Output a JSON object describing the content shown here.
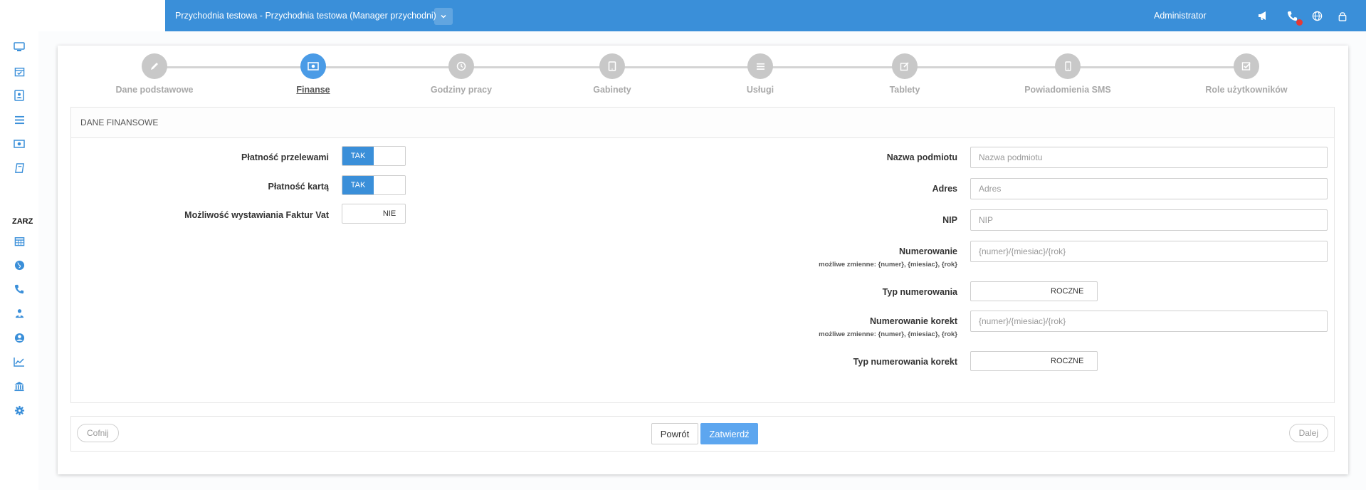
{
  "header": {
    "clinic_title": "Przychodnia testowa - Przychodnia testowa (Manager przychodni)",
    "user": "Administrator",
    "icons": [
      "megaphone-icon",
      "phone-icon",
      "globe-icon",
      "lock-icon"
    ],
    "accent_color": "#3a8fd9"
  },
  "sidebar": {
    "section_label": "ZARZ",
    "icons": [
      "monitor-icon",
      "calendar-check-icon",
      "contact-card-icon",
      "list-icon",
      "money-icon",
      "book-icon",
      "calendar-icon",
      "globe-icon",
      "phone-icon",
      "user-group-icon",
      "user-circle-icon",
      "chart-line-icon",
      "bank-icon",
      "gear-icon"
    ]
  },
  "steps": [
    {
      "label": "Dane podstawowe",
      "icon": "pencil-icon",
      "active": false
    },
    {
      "label": "Finanse",
      "icon": "money-icon",
      "active": true
    },
    {
      "label": "Godziny pracy",
      "icon": "clock-icon",
      "active": false
    },
    {
      "label": "Gabinety",
      "icon": "tablet-icon",
      "active": false
    },
    {
      "label": "Usługi",
      "icon": "list-icon",
      "active": false
    },
    {
      "label": "Tablety",
      "icon": "edit-icon",
      "active": false
    },
    {
      "label": "Powiadomienia SMS",
      "icon": "mobile-icon",
      "active": false
    },
    {
      "label": "Role użytkowników",
      "icon": "checkbox-icon",
      "active": false
    }
  ],
  "panel": {
    "title": "DANE FINANSOWE",
    "left": {
      "transfer_payment": {
        "label": "Płatność przelewami",
        "value": "TAK"
      },
      "card_payment": {
        "label": "Płatność kartą",
        "value": "TAK"
      },
      "vat_invoices": {
        "label": "Możliwość wystawiania Faktur Vat",
        "value": "NIE"
      }
    },
    "right": {
      "entity_name": {
        "label": "Nazwa podmiotu",
        "placeholder": "Nazwa podmiotu",
        "value": ""
      },
      "address": {
        "label": "Adres",
        "placeholder": "Adres",
        "value": ""
      },
      "nip": {
        "label": "NIP",
        "placeholder": "NIP",
        "value": ""
      },
      "numbering": {
        "label": "Numerowanie",
        "hint": "możliwe zmienne: {numer}, {miesiac}, {rok}",
        "placeholder": "{numer}/{miesiac}/{rok}",
        "value": ""
      },
      "numbering_type": {
        "label": "Typ numerowania",
        "value": "ROCZNE"
      },
      "correction_numbering": {
        "label": "Numerowanie korekt",
        "hint": "możliwe zmienne: {numer}, {miesiac}, {rok}",
        "placeholder": "{numer}/{miesiac}/{rok}",
        "value": ""
      },
      "correction_numbering_type": {
        "label": "Typ numerowania korekt",
        "value": "ROCZNE"
      }
    }
  },
  "footer": {
    "prev": "Cofnij",
    "back": "Powrót",
    "confirm": "Zatwierdź",
    "next": "Dalej"
  }
}
